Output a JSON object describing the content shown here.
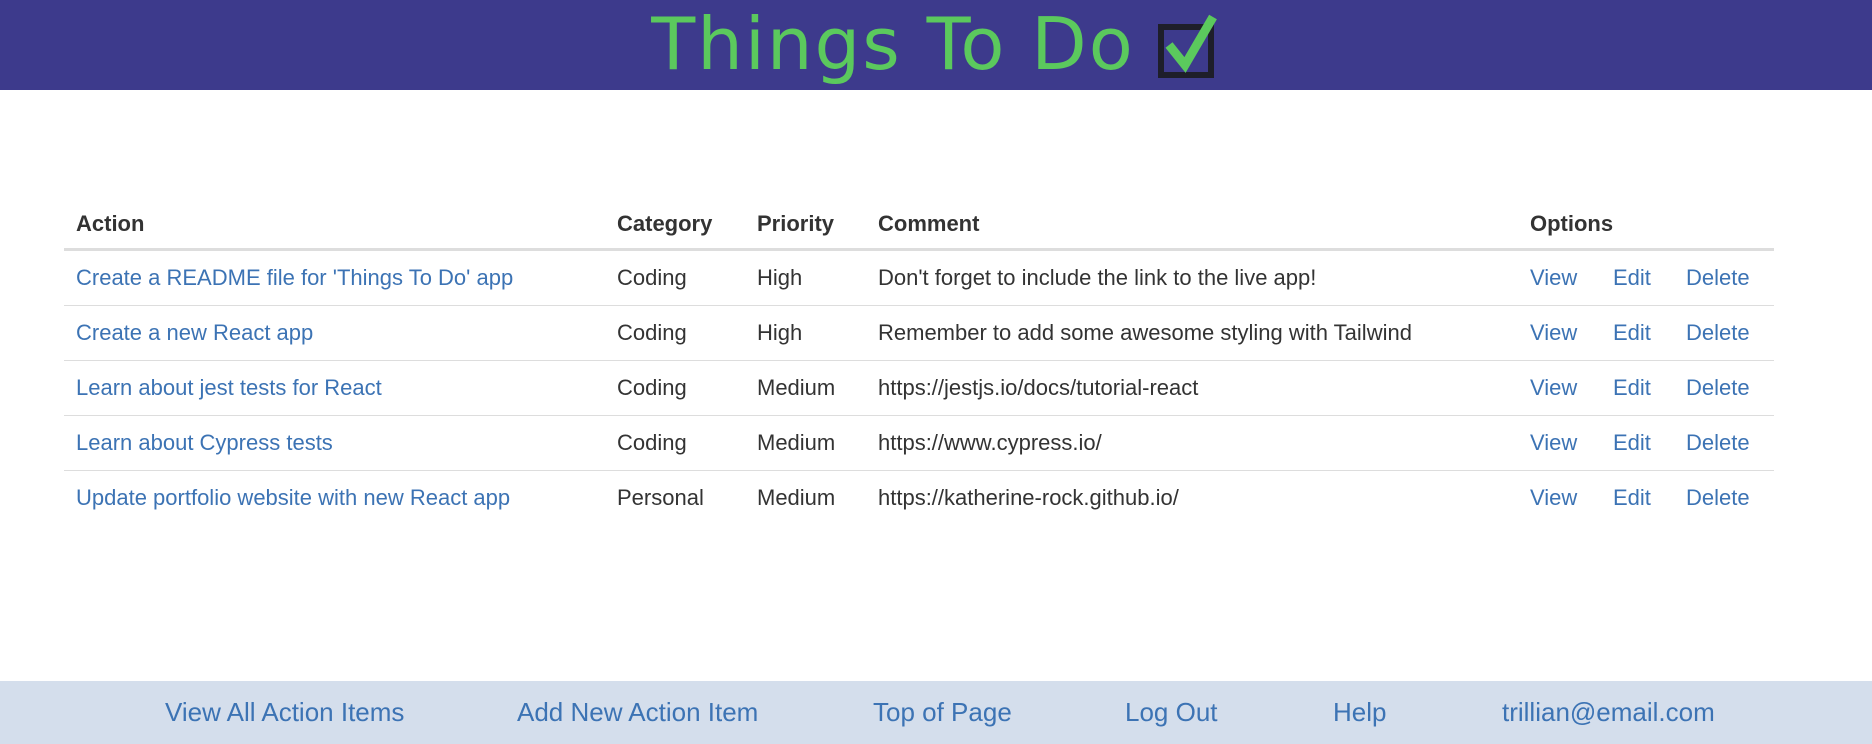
{
  "header": {
    "title": "Things To Do",
    "check_icon": "checkbox-checked-icon",
    "colors": {
      "background": "#3d3a8c",
      "title": "#5bc95d"
    }
  },
  "table": {
    "columns": [
      "Action",
      "Category",
      "Priority",
      "Comment",
      "Options"
    ],
    "rows": [
      {
        "action": "Create a README file for 'Things To Do' app",
        "category": "Coding",
        "priority": "High",
        "comment": "Don't forget to include the link to the live app!"
      },
      {
        "action": "Create a new React app",
        "category": "Coding",
        "priority": "High",
        "comment": "Remember to add some awesome styling with Tailwind"
      },
      {
        "action": "Learn about jest tests for React",
        "category": "Coding",
        "priority": "Medium",
        "comment": "https://jestjs.io/docs/tutorial-react"
      },
      {
        "action": "Learn about Cypress tests",
        "category": "Coding",
        "priority": "Medium",
        "comment": "https://www.cypress.io/"
      },
      {
        "action": "Update portfolio website with new React app",
        "category": "Personal",
        "priority": "Medium",
        "comment": "https://katherine-rock.github.io/"
      }
    ],
    "options": {
      "view": "View",
      "edit": "Edit",
      "delete": "Delete"
    }
  },
  "footer": {
    "links": [
      "View All Action Items",
      "Add New Action Item",
      "Top of Page",
      "Log Out",
      "Help",
      "trillian@email.com"
    ],
    "colors": {
      "background": "#d4deec",
      "link": "#3c73b4"
    }
  }
}
